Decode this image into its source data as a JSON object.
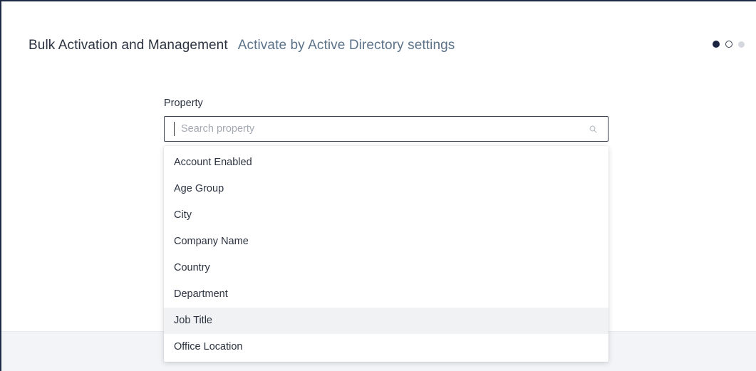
{
  "header": {
    "title": "Bulk Activation and Management",
    "subtitle": "Activate by Active Directory settings"
  },
  "stepper": {
    "total": 3,
    "current": 2,
    "colors": {
      "active": "#1c2541",
      "pending": "#d5d9df"
    }
  },
  "property": {
    "label": "Property",
    "search_placeholder": "Search property",
    "search_value": "",
    "options": [
      "Account Enabled",
      "Age Group",
      "City",
      "Company Name",
      "Country",
      "Department",
      "Job Title",
      "Office Location"
    ],
    "hovered_option": "Job Title"
  },
  "icons": {
    "search": "search-icon"
  }
}
